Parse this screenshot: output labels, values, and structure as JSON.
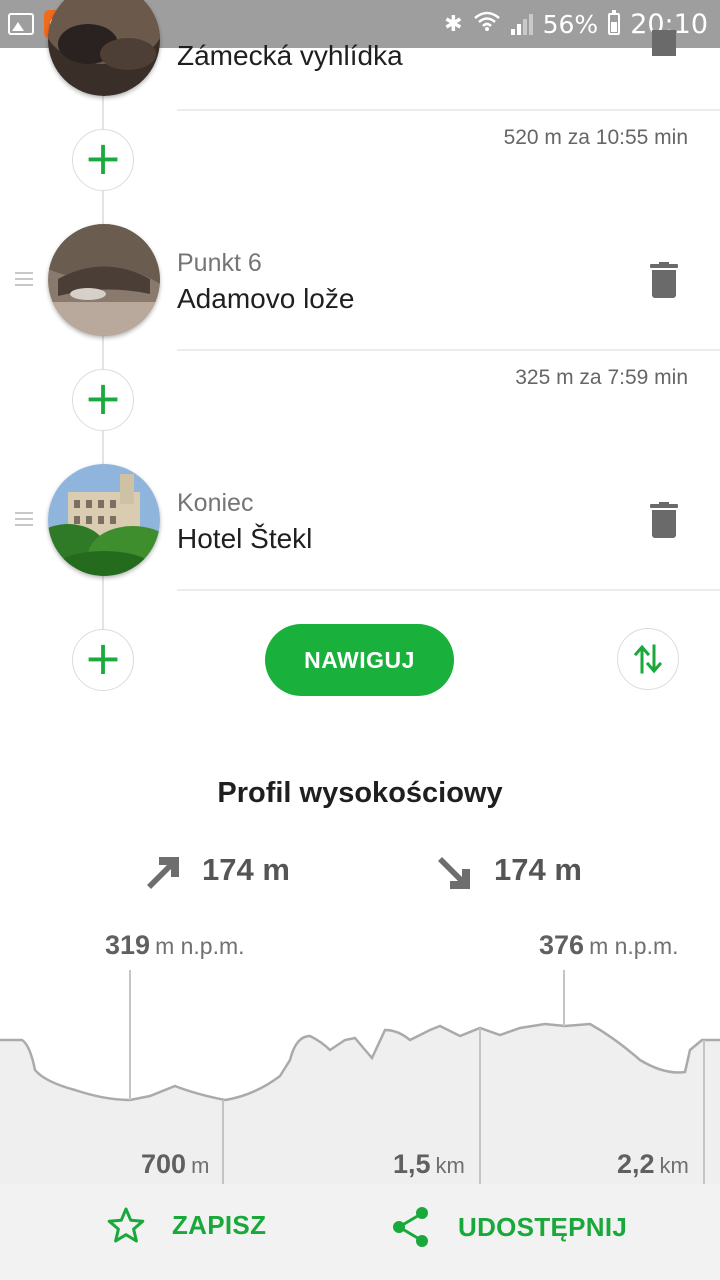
{
  "status_bar": {
    "battery": "56%",
    "time": "20:10"
  },
  "route": {
    "stops": [
      {
        "name": "Zámecká vyhlídka"
      },
      {
        "kind": "Punkt 6",
        "name": "Adamovo lože"
      },
      {
        "kind": "Koniec",
        "name": "Hotel Štekl"
      }
    ],
    "segments": [
      "520 m za 10:55 min",
      "325 m za 7:59 min"
    ],
    "add_symbol": "+",
    "navigate_label": "NAWIGUJ"
  },
  "elevation": {
    "title": "Profil wysokościowy",
    "ascent": "174 m",
    "descent": "174 m",
    "min_marker": {
      "value": "319",
      "unit": "m n.p.m."
    },
    "max_marker": {
      "value": "376",
      "unit": "m n.p.m."
    },
    "distance_marks": [
      {
        "value": "700",
        "unit": "m"
      },
      {
        "value": "1,5",
        "unit": "km"
      },
      {
        "value": "2,2",
        "unit": "km"
      }
    ]
  },
  "actions": {
    "save_label": "ZAPISZ",
    "share_label": "UDOSTĘPNIJ"
  },
  "colors": {
    "accent_green": "#19b13c",
    "status_bar": "#9e9e9e",
    "profile_fill": "#efefef",
    "profile_line": "#aaaaaa"
  },
  "icons": {
    "ascent": "arrow-up-right-icon",
    "descent": "arrow-down-right-icon",
    "swap": "swap-vertical-icon",
    "delete": "trash-icon",
    "save": "star-outline-icon",
    "share": "share-icon"
  }
}
